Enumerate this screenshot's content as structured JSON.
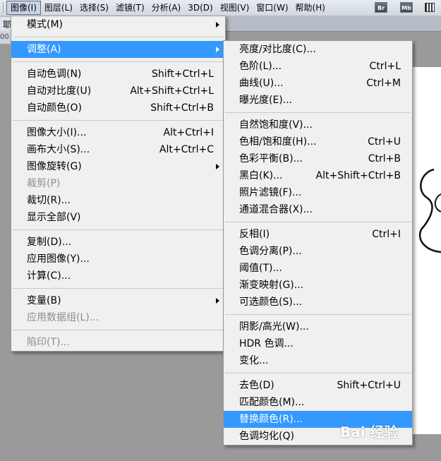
{
  "menubar": {
    "items": [
      {
        "label": "图像(I)",
        "active": true
      },
      {
        "label": "图层(L)"
      },
      {
        "label": "选择(S)"
      },
      {
        "label": "滤镜(T)"
      },
      {
        "label": "分析(A)"
      },
      {
        "label": "3D(D)"
      },
      {
        "label": "视图(V)"
      },
      {
        "label": "窗口(W)"
      },
      {
        "label": "帮助(H)"
      }
    ],
    "buttons": {
      "br": "Br",
      "mb": "Mb"
    }
  },
  "workspace": {
    "tab_fragment": "耶",
    "doc_fragment": "00"
  },
  "image_menu": {
    "groups": [
      [
        {
          "label": "模式(M)",
          "submenu": true
        }
      ],
      [
        {
          "label": "调整(A)",
          "submenu": true,
          "highlight": true
        }
      ],
      [
        {
          "label": "自动色调(N)",
          "shortcut": "Shift+Ctrl+L"
        },
        {
          "label": "自动对比度(U)",
          "shortcut": "Alt+Shift+Ctrl+L"
        },
        {
          "label": "自动颜色(O)",
          "shortcut": "Shift+Ctrl+B"
        }
      ],
      [
        {
          "label": "图像大小(I)...",
          "shortcut": "Alt+Ctrl+I"
        },
        {
          "label": "画布大小(S)...",
          "shortcut": "Alt+Ctrl+C"
        },
        {
          "label": "图像旋转(G)",
          "submenu": true
        },
        {
          "label": "裁剪(P)",
          "disabled": true
        },
        {
          "label": "裁切(R)..."
        },
        {
          "label": "显示全部(V)"
        }
      ],
      [
        {
          "label": "复制(D)..."
        },
        {
          "label": "应用图像(Y)..."
        },
        {
          "label": "计算(C)..."
        }
      ],
      [
        {
          "label": "变量(B)",
          "submenu": true
        },
        {
          "label": "应用数据组(L)...",
          "disabled": true
        }
      ],
      [
        {
          "label": "陷印(T)...",
          "disabled": true
        }
      ]
    ]
  },
  "adjust_menu": {
    "groups": [
      [
        {
          "label": "亮度/对比度(C)..."
        },
        {
          "label": "色阶(L)...",
          "shortcut": "Ctrl+L"
        },
        {
          "label": "曲线(U)...",
          "shortcut": "Ctrl+M"
        },
        {
          "label": "曝光度(E)..."
        }
      ],
      [
        {
          "label": "自然饱和度(V)..."
        },
        {
          "label": "色相/饱和度(H)...",
          "shortcut": "Ctrl+U"
        },
        {
          "label": "色彩平衡(B)...",
          "shortcut": "Ctrl+B"
        },
        {
          "label": "黑白(K)...",
          "shortcut": "Alt+Shift+Ctrl+B"
        },
        {
          "label": "照片滤镜(F)..."
        },
        {
          "label": "通道混合器(X)..."
        }
      ],
      [
        {
          "label": "反相(I)",
          "shortcut": "Ctrl+I"
        },
        {
          "label": "色调分离(P)..."
        },
        {
          "label": "阈值(T)..."
        },
        {
          "label": "渐变映射(G)..."
        },
        {
          "label": "可选颜色(S)..."
        }
      ],
      [
        {
          "label": "阴影/高光(W)..."
        },
        {
          "label": "HDR 色调..."
        },
        {
          "label": "变化..."
        }
      ],
      [
        {
          "label": "去色(D)",
          "shortcut": "Shift+Ctrl+U"
        },
        {
          "label": "匹配颜色(M)..."
        },
        {
          "label": "替换颜色(R)...",
          "highlight": true
        },
        {
          "label": "色调均化(Q)"
        }
      ]
    ]
  },
  "watermark": {
    "text": "Bai 经验"
  }
}
